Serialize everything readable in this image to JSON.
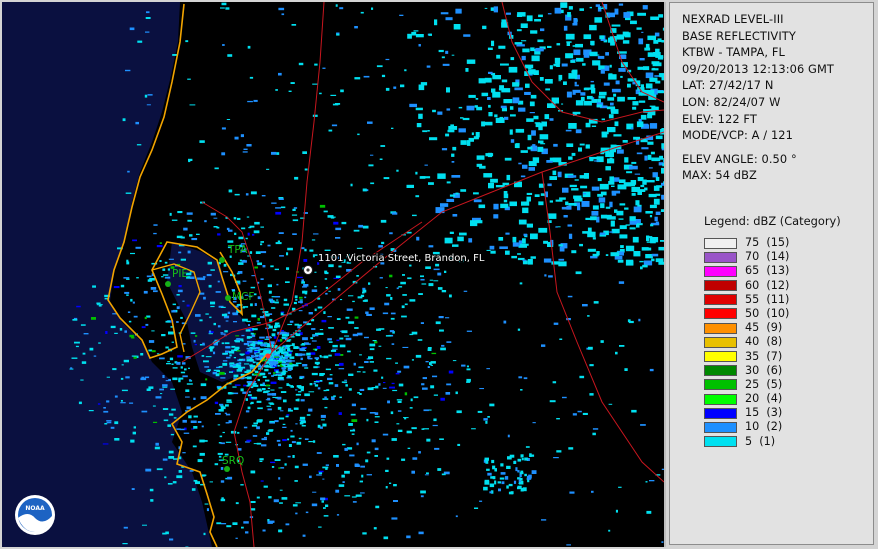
{
  "map": {
    "marker_label": "1101 Victoria Street, Brandon, FL",
    "airports": [
      {
        "code": "TPA"
      },
      {
        "code": "PIE"
      },
      {
        "code": "MCF"
      },
      {
        "code": "SRQ"
      }
    ],
    "logo_text": "NOAA",
    "colors": {
      "background": "#000000",
      "gulf": "#0a1040",
      "coastline": "#f2a400",
      "roads": "#c8161e",
      "airport_dot": "#16b016",
      "airport_label": "#18c018"
    }
  },
  "info": {
    "lines": [
      "NEXRAD LEVEL-III",
      "BASE REFLECTIVITY",
      "KTBW - TAMPA, FL",
      "09/20/2013 12:13:06 GMT",
      "LAT: 27/42/17 N",
      "LON: 82/24/07 W",
      "ELEV: 122 FT",
      "MODE/VCP: A / 121"
    ],
    "extra_lines": [
      "ELEV ANGLE: 0.50 °",
      "MAX: 54 dBZ"
    ],
    "legend_title": "Legend: dBZ (Category)",
    "legend": [
      {
        "label": "75  (15)",
        "color": "#f0f0f0"
      },
      {
        "label": "70  (14)",
        "color": "#9955c8"
      },
      {
        "label": "65  (13)",
        "color": "#ff00ff"
      },
      {
        "label": "60  (12)",
        "color": "#c00000"
      },
      {
        "label": "55  (11)",
        "color": "#e00000"
      },
      {
        "label": "50  (10)",
        "color": "#ff0000"
      },
      {
        "label": "45  (9)",
        "color": "#ff9000"
      },
      {
        "label": "40  (8)",
        "color": "#e8c000"
      },
      {
        "label": "35  (7)",
        "color": "#ffff00"
      },
      {
        "label": "30  (6)",
        "color": "#008800"
      },
      {
        "label": "25  (5)",
        "color": "#00c000"
      },
      {
        "label": "20  (4)",
        "color": "#00ff00"
      },
      {
        "label": "15  (3)",
        "color": "#0000ff"
      },
      {
        "label": "10  (2)",
        "color": "#1e90ff"
      },
      {
        "label": "5  (1)",
        "color": "#00e0f0"
      }
    ]
  }
}
